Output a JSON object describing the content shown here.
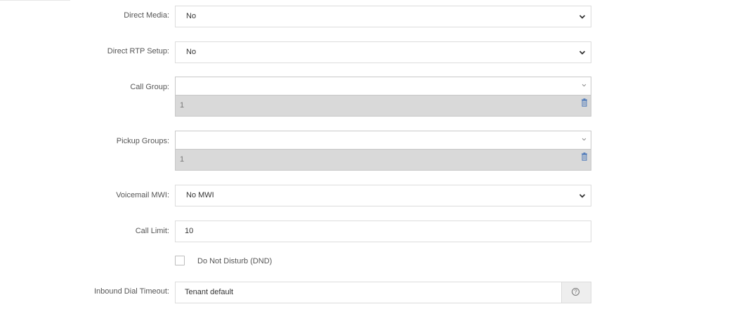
{
  "fields": {
    "direct_media": {
      "label": "Direct Media:",
      "value": "No"
    },
    "direct_rtp_setup": {
      "label": "Direct RTP Setup:",
      "value": "No"
    },
    "call_group": {
      "label": "Call Group:",
      "value": "",
      "tags": [
        "1"
      ]
    },
    "pickup_groups": {
      "label": "Pickup Groups:",
      "value": "",
      "tags": [
        "1"
      ]
    },
    "voicemail_mwi": {
      "label": "Voicemail MWI:",
      "value": "No MWI"
    },
    "call_limit": {
      "label": "Call Limit:",
      "value": "10"
    },
    "dnd": {
      "label": "Do Not Disturb (DND)",
      "checked": false
    },
    "inbound_dial_timeout": {
      "label": "Inbound Dial Timeout:",
      "value": "Tenant default"
    }
  },
  "icons": {
    "chevron": "chevron-down-icon",
    "trash": "trash-icon",
    "help": "help-icon"
  },
  "help_glyph": "?"
}
